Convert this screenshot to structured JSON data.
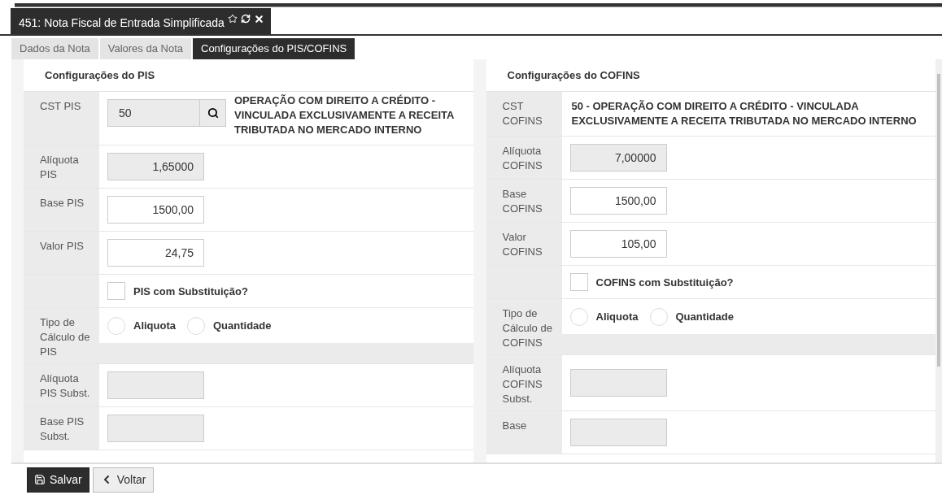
{
  "window": {
    "title": "451: Nota Fiscal de Entrada Simplificada"
  },
  "tabs": [
    {
      "label": "Dados da Nota",
      "selected": false
    },
    {
      "label": "Valores da Nota",
      "selected": false
    },
    {
      "label": "Configurações do PIS/COFINS",
      "selected": true
    }
  ],
  "panels": [
    {
      "title": "Configurações do PIS",
      "rows": [
        {
          "kind": "lookup",
          "label": "CST PIS",
          "value": "50",
          "disabled": true,
          "description": "OPERAÇÃO COM DIREITO A CRÉDITO - VINCULADA EXCLUSIVAMENTE A RECEITA TRIBUTADA NO MERCADO INTERNO"
        },
        {
          "kind": "input",
          "label": "Alíquota PIS",
          "value": "1,65000",
          "disabled": true
        },
        {
          "kind": "input",
          "label": "Base PIS",
          "value": "1500,00",
          "disabled": false
        },
        {
          "kind": "input",
          "label": "Valor PIS",
          "value": "24,75",
          "disabled": false
        },
        {
          "kind": "checkbox",
          "text": "PIS com Substituição?",
          "checked": false
        },
        {
          "kind": "radio",
          "label": "Tipo de Cálculo de PIS",
          "options": [
            {
              "label": "Aliquota",
              "selected": false
            },
            {
              "label": "Quantidade",
              "selected": false
            }
          ]
        },
        {
          "kind": "input",
          "label": "Alíquota PIS Subst.",
          "disabled": true
        },
        {
          "kind": "input",
          "label": "Base PIS Subst.",
          "disabled": true
        }
      ]
    },
    {
      "title": "Configurações do COFINS",
      "rows": [
        {
          "kind": "text",
          "label": "CST COFINS",
          "description": "50 - OPERAÇÃO COM DIREITO A CRÉDITO - VINCULADA EXCLUSIVAMENTE A RECEITA TRIBUTADA NO MERCADO INTERNO"
        },
        {
          "kind": "input",
          "label": "Alíquota COFINS",
          "value": "7,00000",
          "disabled": true
        },
        {
          "kind": "input",
          "label": "Base COFINS",
          "value": "1500,00",
          "disabled": false
        },
        {
          "kind": "input",
          "label": "Valor COFINS",
          "value": "105,00",
          "disabled": false
        },
        {
          "kind": "checkbox",
          "text": "COFINS com Substituição?",
          "checked": false
        },
        {
          "kind": "radio",
          "label": "Tipo de Cálculo de COFINS",
          "options": [
            {
              "label": "Aliquota",
              "selected": false
            },
            {
              "label": "Quantidade",
              "selected": false
            }
          ]
        },
        {
          "kind": "input",
          "label": "Alíquota COFINS Subst.",
          "disabled": true
        },
        {
          "kind": "input",
          "label": "Base",
          "disabled": true
        }
      ]
    }
  ],
  "buttons": [
    {
      "kind": "save",
      "label": "Salvar"
    },
    {
      "kind": "back",
      "label": "Voltar"
    }
  ]
}
